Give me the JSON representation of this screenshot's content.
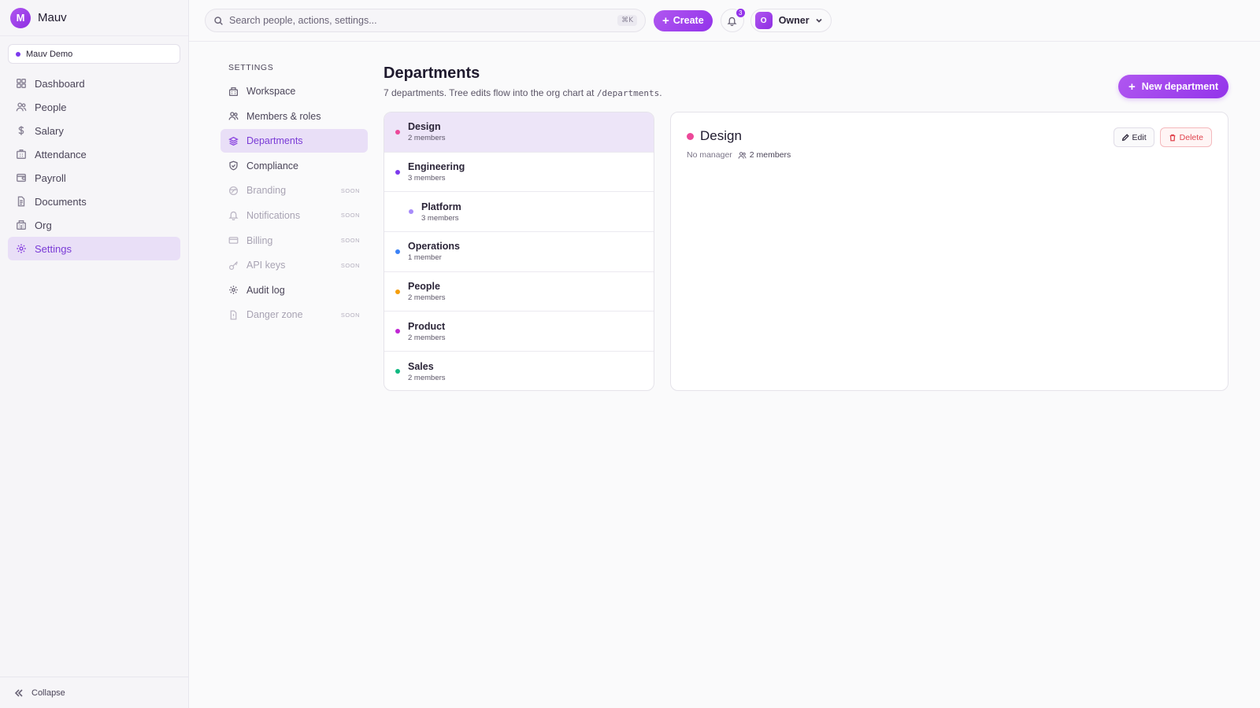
{
  "brand": {
    "logo_letter": "M",
    "name": "Mauv"
  },
  "workspace": {
    "name": "Mauv Demo"
  },
  "sidebar": {
    "items": [
      {
        "label": "Dashboard",
        "icon": "grid-icon"
      },
      {
        "label": "People",
        "icon": "users-icon"
      },
      {
        "label": "Salary",
        "icon": "dollar-icon"
      },
      {
        "label": "Attendance",
        "icon": "building-icon"
      },
      {
        "label": "Payroll",
        "icon": "wallet-icon"
      },
      {
        "label": "Documents",
        "icon": "document-icon"
      },
      {
        "label": "Org",
        "icon": "org-icon"
      },
      {
        "label": "Settings",
        "icon": "gear-icon",
        "active": true
      }
    ],
    "collapse_label": "Collapse"
  },
  "topbar": {
    "search_placeholder": "Search people, actions, settings...",
    "search_shortcut": "⌘K",
    "create_label": "Create",
    "notification_count": "3",
    "user_initial": "O",
    "user_role": "Owner"
  },
  "settings_nav": {
    "heading": "SETTINGS",
    "items": [
      {
        "label": "Workspace",
        "icon": "building-icon"
      },
      {
        "label": "Members & roles",
        "icon": "users-icon"
      },
      {
        "label": "Departments",
        "icon": "layers-icon",
        "active": true
      },
      {
        "label": "Compliance",
        "icon": "shield-icon"
      },
      {
        "label": "Branding",
        "icon": "palette-icon",
        "soon": "SOON"
      },
      {
        "label": "Notifications",
        "icon": "bell-icon",
        "soon": "SOON"
      },
      {
        "label": "Billing",
        "icon": "credit-card-icon",
        "soon": "SOON"
      },
      {
        "label": "API keys",
        "icon": "key-icon",
        "soon": "SOON"
      },
      {
        "label": "Audit log",
        "icon": "gear-icon"
      },
      {
        "label": "Danger zone",
        "icon": "file-alert-icon",
        "soon": "SOON"
      }
    ]
  },
  "page": {
    "title": "Departments",
    "subtitle_prefix": "7 departments. Tree edits flow into the org chart at ",
    "subtitle_path": "/departments",
    "subtitle_suffix": ".",
    "new_button": "New department"
  },
  "departments": [
    {
      "name": "Design",
      "count": "2 members",
      "color": "#ec4899",
      "selected": true
    },
    {
      "name": "Engineering",
      "count": "3 members",
      "color": "#7c3aed"
    },
    {
      "name": "Platform",
      "count": "3 members",
      "color": "#a78bfa",
      "child": true
    },
    {
      "name": "Operations",
      "count": "1 member",
      "color": "#3b82f6"
    },
    {
      "name": "People",
      "count": "2 members",
      "color": "#f59e0b"
    },
    {
      "name": "Product",
      "count": "2 members",
      "color": "#c026d3"
    },
    {
      "name": "Sales",
      "count": "2 members",
      "color": "#10b981"
    }
  ],
  "detail": {
    "name": "Design",
    "color": "#ec4899",
    "manager": "No manager",
    "members": "2 members",
    "edit_label": "Edit",
    "delete_label": "Delete"
  }
}
